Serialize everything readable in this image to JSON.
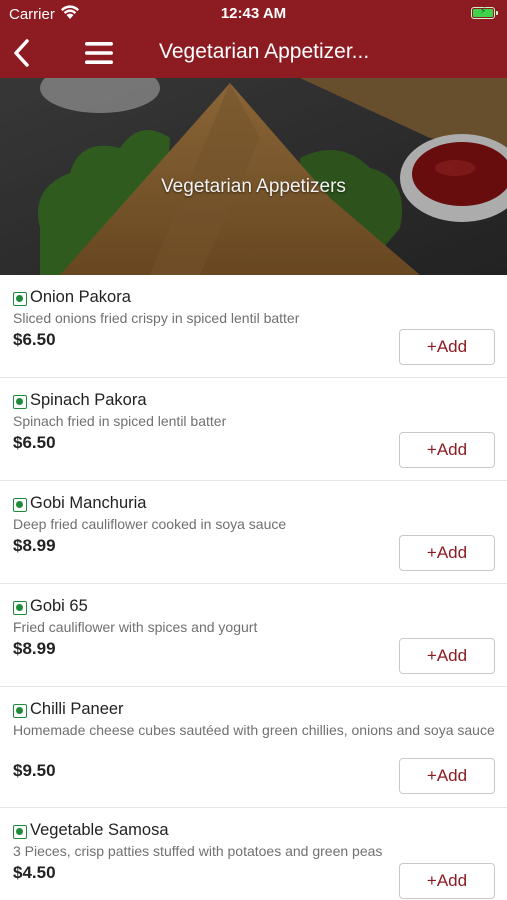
{
  "status_bar": {
    "carrier": "Carrier",
    "time": "12:43 AM"
  },
  "nav": {
    "title": "Vegetarian Appetizer..."
  },
  "banner": {
    "title": "Vegetarian Appetizers"
  },
  "colors": {
    "brand": "#8c1c22",
    "veg_marker": "#1e8a3a"
  },
  "items": [
    {
      "name": "Onion Pakora",
      "description": "Sliced onions fried crispy in spiced lentil batter",
      "price": "$6.50",
      "add_label": "+Add"
    },
    {
      "name": "Spinach Pakora",
      "description": "Spinach fried in spiced lentil batter",
      "price": "$6.50",
      "add_label": "+Add"
    },
    {
      "name": "Gobi Manchuria",
      "description": "Deep fried cauliflower cooked in soya sauce",
      "price": "$8.99",
      "add_label": "+Add"
    },
    {
      "name": "Gobi 65",
      "description": "Fried cauliflower with spices and yogurt",
      "price": "$8.99",
      "add_label": "+Add"
    },
    {
      "name": "Chilli Paneer",
      "description": "Homemade cheese cubes sautéed with green chillies, onions and soya sauce",
      "price": "$9.50",
      "add_label": "+Add"
    },
    {
      "name": "Vegetable Samosa",
      "description": "3 Pieces, crisp patties stuffed with potatoes and green peas",
      "price": "$4.50",
      "add_label": "+Add"
    }
  ]
}
